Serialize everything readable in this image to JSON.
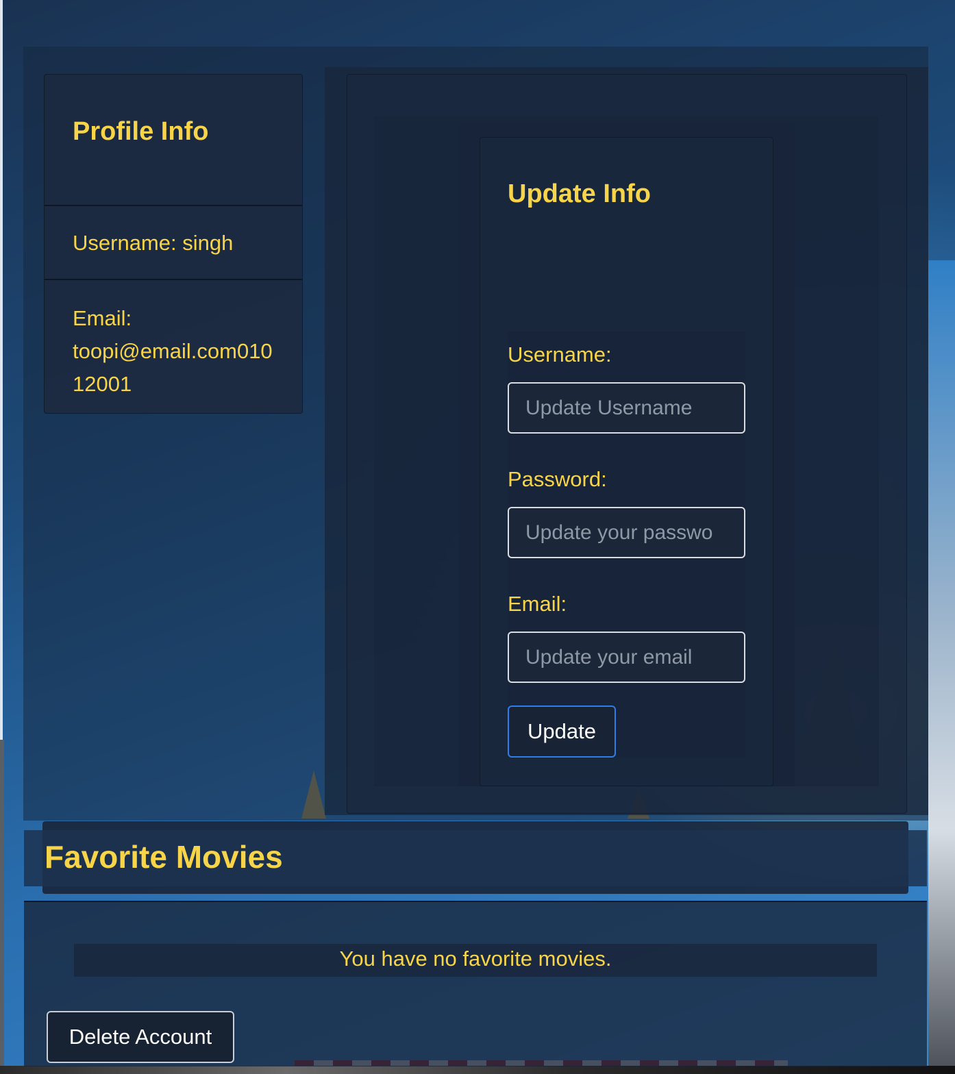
{
  "profile": {
    "title": "Profile Info",
    "username_line": "Username: singh",
    "email_label": "Email:",
    "email_value": "toopi@email.com01012001"
  },
  "update_form": {
    "title": "Update Info",
    "username_label": "Username:",
    "username_placeholder": "Update Username",
    "password_label": "Password:",
    "password_placeholder": "Update your passwo",
    "email_label": "Email:",
    "email_placeholder": "Update your email",
    "submit_label": "Update"
  },
  "favorites": {
    "title": "Favorite Movies",
    "empty_message": "You have no favorite movies."
  },
  "account": {
    "delete_label": "Delete Account"
  },
  "colors": {
    "accent_text": "#f7d448",
    "button_border_primary": "#2f7ee8",
    "panel_bg": "#1c2940"
  }
}
